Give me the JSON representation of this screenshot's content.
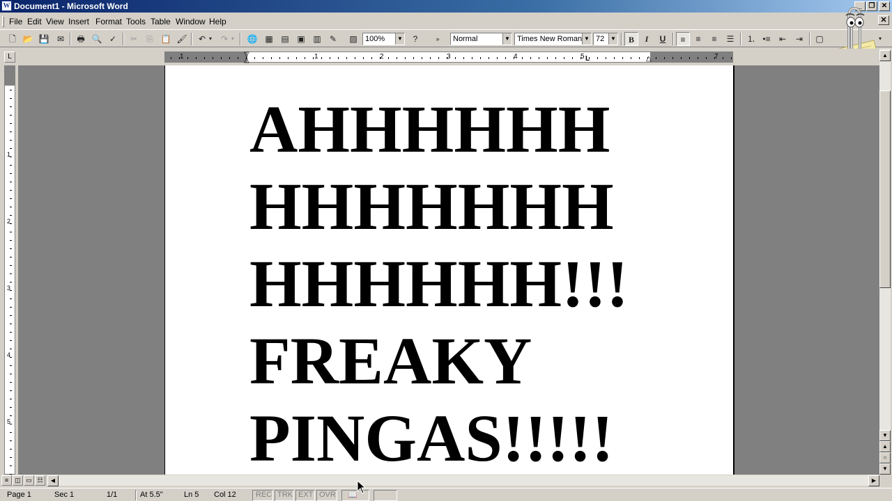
{
  "window": {
    "title": "Document1 - Microsoft Word",
    "app_icon": "W"
  },
  "menu": [
    "File",
    "Edit",
    "View",
    "Insert",
    "Format",
    "Tools",
    "Table",
    "Window",
    "Help"
  ],
  "toolbar": {
    "zoom": "100%",
    "style": "Normal",
    "font": "Times New Roman",
    "size": "72",
    "bold": "B",
    "italic": "I",
    "underline": "U"
  },
  "ruler": {
    "h_numbers": [
      "1",
      "1",
      "2",
      "3",
      "4",
      "5",
      "7"
    ],
    "v_numbers": [
      "1",
      "2",
      "3",
      "4",
      "5"
    ]
  },
  "document": {
    "lines": [
      "AHHHHHH",
      "HHHHHHH",
      "HHHHHH!!!",
      "FREAKY",
      "PINGAS!!!!!"
    ]
  },
  "status": {
    "page": "Page 1",
    "sec": "Sec 1",
    "count": "1/1",
    "at": "At 5.5\"",
    "ln": "Ln 5",
    "col": "Col 12",
    "rec": "REC",
    "trk": "TRK",
    "ext": "EXT",
    "ovr": "OVR"
  }
}
